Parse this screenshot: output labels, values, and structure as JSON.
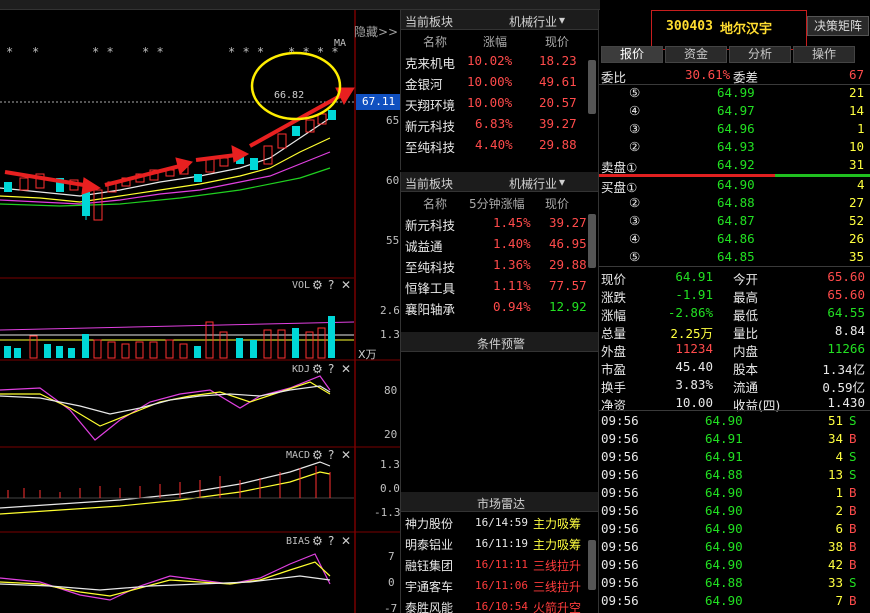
{
  "chart": {
    "hide_label": "隐藏>>",
    "ma_label": "MA",
    "price_label": "66.82",
    "current_price": "67.11",
    "price_ticks": [
      "65",
      "60",
      "55"
    ],
    "vol_label": "VOL",
    "vol_ticks": [
      "2.6",
      "1.3"
    ],
    "vol_unit": "X万",
    "kdj_label": "KDJ",
    "kdj_ticks": [
      "80",
      "20"
    ],
    "macd_label": "MACD",
    "macd_ticks": [
      "1.3",
      "0.0",
      "-1.3"
    ],
    "bias_label": "BIAS",
    "bias_ticks": [
      "7",
      "0",
      "-7"
    ],
    "help_icon": "?",
    "close_icon": "✕"
  },
  "sector1": {
    "title": "当前板块",
    "selector": "机械行业",
    "col_name": "名称",
    "col_change": "涨幅",
    "col_price": "现价",
    "rows": [
      {
        "name": "克来机电",
        "change": "10.02%",
        "price": "18.23"
      },
      {
        "name": "金银河",
        "change": "10.00%",
        "price": "49.61"
      },
      {
        "name": "天翔环境",
        "change": "10.00%",
        "price": "20.57"
      },
      {
        "name": "新元科技",
        "change": "6.83%",
        "price": "39.27"
      },
      {
        "name": "至纯科技",
        "change": "4.40%",
        "price": "29.88"
      }
    ]
  },
  "sector2": {
    "title": "当前板块",
    "selector": "机械行业",
    "col_name": "名称",
    "col_change": "5分钟涨幅",
    "col_price": "现价",
    "rows": [
      {
        "name": "新元科技",
        "change": "1.45%",
        "price": "39.27"
      },
      {
        "name": "诚益通",
        "change": "1.40%",
        "price": "46.95"
      },
      {
        "name": "至纯科技",
        "change": "1.36%",
        "price": "29.88"
      },
      {
        "name": "恒锋工具",
        "change": "1.11%",
        "price": "77.57"
      },
      {
        "name": "襄阳轴承",
        "change": "0.94%",
        "price": "12.92"
      }
    ]
  },
  "alert": {
    "title": "条件预警"
  },
  "radar": {
    "title": "市场雷达",
    "rows": [
      {
        "name": "神力股份",
        "time": "16/14:59",
        "event": "主力吸筹",
        "kind": "yellow"
      },
      {
        "name": "明泰铝业",
        "time": "16/11:19",
        "event": "主力吸筹",
        "kind": "yellow"
      },
      {
        "name": "融钰集团",
        "time": "16/11:11",
        "event": "三线拉升",
        "kind": "red"
      },
      {
        "name": "宇通客车",
        "time": "16/11:06",
        "event": "三线拉升",
        "kind": "red"
      },
      {
        "name": "泰胜风能",
        "time": "16/10:54",
        "event": "火箭升空",
        "kind": "red"
      }
    ]
  },
  "quote": {
    "code": "300403",
    "name": "地尔汉宇",
    "decision_btn": "决策矩阵",
    "tabs": [
      "报价",
      "资金",
      "分析",
      "操作"
    ],
    "weibi_label": "委比",
    "weibi_value": "30.61%",
    "weicha_label": "委差",
    "weicha_value": "67",
    "sell": [
      {
        "label": "⑤",
        "price": "64.99",
        "vol": "21"
      },
      {
        "label": "④",
        "price": "64.97",
        "vol": "14"
      },
      {
        "label": "③",
        "price": "64.96",
        "vol": "1"
      },
      {
        "label": "②",
        "price": "64.93",
        "vol": "10"
      },
      {
        "label": "卖盘①",
        "price": "64.92",
        "vol": "31"
      }
    ],
    "buy": [
      {
        "label": "买盘①",
        "price": "64.90",
        "vol": "4"
      },
      {
        "label": "②",
        "price": "64.88",
        "vol": "27"
      },
      {
        "label": "③",
        "price": "64.87",
        "vol": "52"
      },
      {
        "label": "④",
        "price": "64.86",
        "vol": "26"
      },
      {
        "label": "⑤",
        "price": "64.85",
        "vol": "35"
      }
    ],
    "stats": [
      {
        "l1": "现价",
        "v1": "64.91",
        "c1": "green",
        "l2": "今开",
        "v2": "65.60",
        "c2": "red"
      },
      {
        "l1": "涨跌",
        "v1": "-1.91",
        "c1": "green",
        "l2": "最高",
        "v2": "65.60",
        "c2": "red"
      },
      {
        "l1": "涨幅",
        "v1": "-2.86%",
        "c1": "green",
        "l2": "最低",
        "v2": "64.55",
        "c2": "green"
      },
      {
        "l1": "总量",
        "v1": "2.25万",
        "c1": "yellow",
        "l2": "量比",
        "v2": "8.84",
        "c2": "white"
      },
      {
        "l1": "外盘",
        "v1": "11234",
        "c1": "red",
        "l2": "内盘",
        "v2": "11266",
        "c2": "green"
      },
      {
        "l1": "市盈",
        "v1": "45.40",
        "c1": "white",
        "l2": "股本",
        "v2": "1.34亿",
        "c2": "white"
      },
      {
        "l1": "换手",
        "v1": "3.83%",
        "c1": "white",
        "l2": "流通",
        "v2": "0.59亿",
        "c2": "white"
      },
      {
        "l1": "净资",
        "v1": "10.00",
        "c1": "white",
        "l2": "收益(四)",
        "v2": "1.430",
        "c2": "white"
      }
    ],
    "ticks": [
      {
        "time": "09:56",
        "price": "64.90",
        "vol": "51",
        "side": "S"
      },
      {
        "time": "09:56",
        "price": "64.91",
        "vol": "34",
        "side": "B"
      },
      {
        "time": "09:56",
        "price": "64.91",
        "vol": "4",
        "side": "S"
      },
      {
        "time": "09:56",
        "price": "64.88",
        "vol": "13",
        "side": "S"
      },
      {
        "time": "09:56",
        "price": "64.90",
        "vol": "1",
        "side": "B"
      },
      {
        "time": "09:56",
        "price": "64.90",
        "vol": "2",
        "side": "B"
      },
      {
        "time": "09:56",
        "price": "64.90",
        "vol": "6",
        "side": "B"
      },
      {
        "time": "09:56",
        "price": "64.90",
        "vol": "38",
        "side": "B"
      },
      {
        "time": "09:56",
        "price": "64.90",
        "vol": "42",
        "side": "B"
      },
      {
        "time": "09:56",
        "price": "64.88",
        "vol": "33",
        "side": "S"
      },
      {
        "time": "09:56",
        "price": "64.90",
        "vol": "7",
        "side": "B"
      }
    ]
  }
}
